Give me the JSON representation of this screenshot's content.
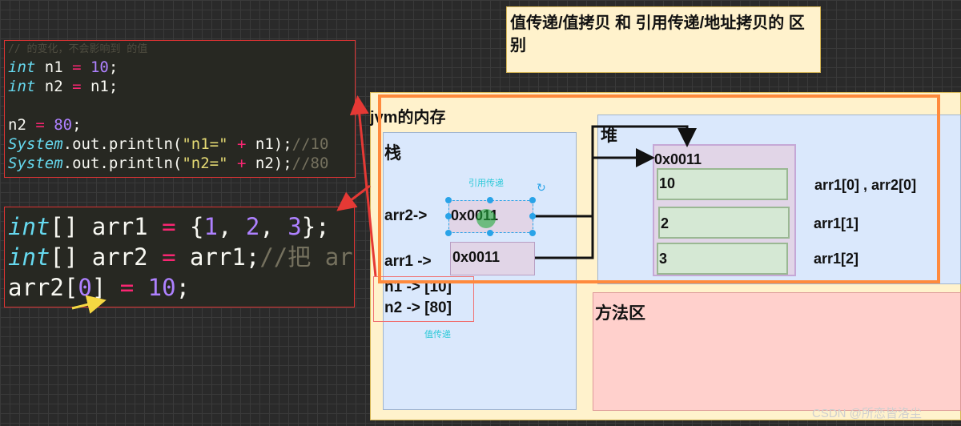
{
  "title_note": "值传递/值拷贝 和  引用传递/地址拷贝的 区别",
  "code_top": {
    "faded_line": "// 的变化，不会影响到 的值",
    "lines": [
      {
        "kw": "int",
        "rest": " n1 ",
        "op": "=",
        "num": " 10",
        ";": ";"
      },
      {
        "kw": "int",
        "rest": " n2 ",
        "op": "=",
        "tail": " n1;"
      }
    ],
    "l1_kw": "int",
    "l1_a": " n1 ",
    "l1_op": "=",
    "l1_num": " 10",
    "l1_end": ";",
    "l2_kw": "int",
    "l2_a": " n2 ",
    "l2_op": "=",
    "l2_end": " n1;",
    "l3_a": "n2 ",
    "l3_op": "=",
    "l3_num": " 80",
    "l3_end": ";",
    "l4_kw": "System",
    "l4_a": ".out.println(",
    "l4_str": "\"n1=\"",
    "l4_op": " + ",
    "l4_b": "n1);",
    "l4_cm": "//10",
    "l5_kw": "System",
    "l5_a": ".out.println(",
    "l5_str": "\"n2=\"",
    "l5_op": " + ",
    "l5_b": "n2);",
    "l5_cm": "//80"
  },
  "code_bottom": {
    "l1_kw": "int",
    "l1_a": "[] arr1 ",
    "l1_op": "=",
    "l1_b": " {",
    "n1": "1",
    ", ": ", ",
    "n2": "2",
    "n3": "3",
    "l1_end": "};",
    "l2_kw": "int",
    "l2_a": "[] arr2 ",
    "l2_op": "=",
    "l2_b": " arr1;",
    "l2_cm": "//把 ar",
    "l3_a": "arr2[",
    "l3_num": "0",
    "l3_b": "] ",
    "l3_op": "=",
    "l3_num2": " 10",
    "l3_end": ";"
  },
  "jvm": {
    "title": "jvm的内存",
    "stack": {
      "label": "栈",
      "ref_note": "引用传递",
      "value_note": "值传递",
      "arr2_label": "arr2->",
      "arr2_value": "0x0011",
      "arr1_label": "arr1 ->",
      "arr1_value": "0x0011",
      "n1": "n1 -> [10]",
      "n2": "n2 -> [80]"
    },
    "heap": {
      "label": "堆",
      "address": "0x0011",
      "cells": [
        "10",
        "2",
        "3"
      ],
      "cell_labels": [
        "arr1[0] , arr2[0]",
        "arr1[1]",
        "arr1[2]"
      ]
    },
    "method_area": {
      "label": "方法区"
    }
  },
  "watermark": "CSDN @所恋皆洛尘",
  "colors": {
    "note_bg": "#fff2cc",
    "stack_bg": "#dae8fc",
    "array_bg": "#e1d5e7",
    "cell_bg": "#d5e8d4",
    "method_bg": "#ffd0cc",
    "highlight": "#ff8a3d",
    "annotation": "#e53935"
  }
}
